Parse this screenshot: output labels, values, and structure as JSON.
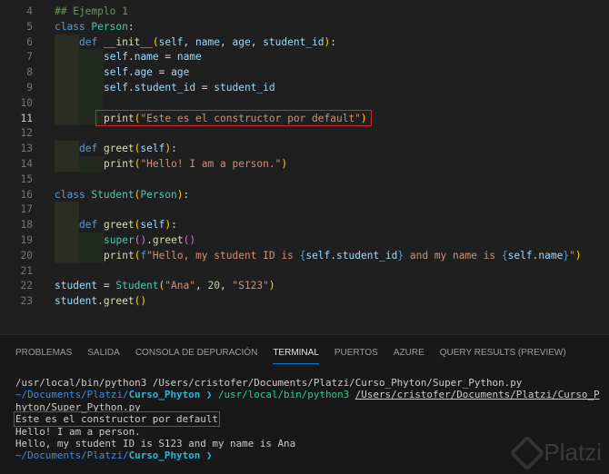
{
  "editor": {
    "active_line": 11,
    "lines": [
      {
        "n": "4",
        "indent": 0,
        "tokens": [
          [
            "## Ejemplo 1",
            "cm"
          ]
        ]
      },
      {
        "n": "5",
        "indent": 0,
        "tokens": [
          [
            "class ",
            "kw"
          ],
          [
            "Person",
            "cls"
          ],
          [
            ":",
            "pn"
          ]
        ]
      },
      {
        "n": "6",
        "indent": 1,
        "tokens": [
          [
            "def ",
            "kw"
          ],
          [
            "__init__",
            "fn"
          ],
          [
            "(",
            "br"
          ],
          [
            "self",
            "self"
          ],
          [
            ", ",
            "pn"
          ],
          [
            "name",
            "var"
          ],
          [
            ", ",
            "pn"
          ],
          [
            "age",
            "var"
          ],
          [
            ", ",
            "pn"
          ],
          [
            "student_id",
            "var"
          ],
          [
            ")",
            "br"
          ],
          [
            ":",
            "pn"
          ]
        ]
      },
      {
        "n": "7",
        "indent": 2,
        "tokens": [
          [
            "self",
            "self"
          ],
          [
            ".",
            "pn"
          ],
          [
            "name",
            "var"
          ],
          [
            " = ",
            "pn"
          ],
          [
            "name",
            "var"
          ]
        ]
      },
      {
        "n": "8",
        "indent": 2,
        "tokens": [
          [
            "self",
            "self"
          ],
          [
            ".",
            "pn"
          ],
          [
            "age",
            "var"
          ],
          [
            " = ",
            "pn"
          ],
          [
            "age",
            "var"
          ]
        ]
      },
      {
        "n": "9",
        "indent": 2,
        "tokens": [
          [
            "self",
            "self"
          ],
          [
            ".",
            "pn"
          ],
          [
            "student_id",
            "var"
          ],
          [
            " = ",
            "pn"
          ],
          [
            "student_id",
            "var"
          ]
        ]
      },
      {
        "n": "10",
        "indent": 2,
        "tokens": []
      },
      {
        "n": "11",
        "indent": 2,
        "tokens": [
          [
            "print",
            "fn"
          ],
          [
            "(",
            "br"
          ],
          [
            "\"Este es el constructor por default\"",
            "str"
          ],
          [
            ")",
            "br"
          ]
        ]
      },
      {
        "n": "12",
        "indent": 0,
        "tokens": []
      },
      {
        "n": "13",
        "indent": 1,
        "tokens": [
          [
            "def ",
            "kw"
          ],
          [
            "greet",
            "fn"
          ],
          [
            "(",
            "br"
          ],
          [
            "self",
            "self"
          ],
          [
            ")",
            "br"
          ],
          [
            ":",
            "pn"
          ]
        ]
      },
      {
        "n": "14",
        "indent": 2,
        "tokens": [
          [
            "print",
            "fn"
          ],
          [
            "(",
            "br"
          ],
          [
            "\"Hello! I am a person.\"",
            "str"
          ],
          [
            ")",
            "br"
          ]
        ]
      },
      {
        "n": "15",
        "indent": 0,
        "tokens": []
      },
      {
        "n": "16",
        "indent": 0,
        "tokens": [
          [
            "class ",
            "kw"
          ],
          [
            "Student",
            "cls"
          ],
          [
            "(",
            "br"
          ],
          [
            "Person",
            "cls"
          ],
          [
            ")",
            "br"
          ],
          [
            ":",
            "pn"
          ]
        ]
      },
      {
        "n": "17",
        "indent": 1,
        "tokens": []
      },
      {
        "n": "18",
        "indent": 1,
        "tokens": [
          [
            "def ",
            "kw"
          ],
          [
            "greet",
            "fn"
          ],
          [
            "(",
            "br"
          ],
          [
            "self",
            "self"
          ],
          [
            ")",
            "br"
          ],
          [
            ":",
            "pn"
          ]
        ]
      },
      {
        "n": "19",
        "indent": 2,
        "tokens": [
          [
            "super",
            "cls"
          ],
          [
            "()",
            "br2"
          ],
          [
            ".",
            "pn"
          ],
          [
            "greet",
            "fn"
          ],
          [
            "()",
            "br2"
          ]
        ]
      },
      {
        "n": "20",
        "indent": 2,
        "tokens": [
          [
            "print",
            "fn"
          ],
          [
            "(",
            "br"
          ],
          [
            "f",
            "kw"
          ],
          [
            "\"Hello, my student ID is ",
            "str"
          ],
          [
            "{",
            "kw"
          ],
          [
            "self",
            "self"
          ],
          [
            ".",
            "pn"
          ],
          [
            "student_id",
            "var"
          ],
          [
            "}",
            "kw"
          ],
          [
            " and my name is ",
            "str"
          ],
          [
            "{",
            "kw"
          ],
          [
            "self",
            "self"
          ],
          [
            ".",
            "pn"
          ],
          [
            "name",
            "var"
          ],
          [
            "}",
            "kw"
          ],
          [
            "\"",
            "str"
          ],
          [
            ")",
            "br"
          ]
        ]
      },
      {
        "n": "21",
        "indent": 0,
        "tokens": []
      },
      {
        "n": "22",
        "indent": 0,
        "tokens": [
          [
            "student",
            "var"
          ],
          [
            " = ",
            "pn"
          ],
          [
            "Student",
            "cls"
          ],
          [
            "(",
            "br"
          ],
          [
            "\"Ana\"",
            "str"
          ],
          [
            ", ",
            "pn"
          ],
          [
            "20",
            "num"
          ],
          [
            ", ",
            "pn"
          ],
          [
            "\"S123\"",
            "str"
          ],
          [
            ")",
            "br"
          ]
        ]
      },
      {
        "n": "23",
        "indent": 0,
        "tokens": [
          [
            "student",
            "var"
          ],
          [
            ".",
            "pn"
          ],
          [
            "greet",
            "fn"
          ],
          [
            "()",
            "br"
          ]
        ]
      }
    ]
  },
  "panel": {
    "tabs": [
      {
        "label": "PROBLEMAS",
        "active": false
      },
      {
        "label": "SALIDA",
        "active": false
      },
      {
        "label": "CONSOLA DE DEPURACIÓN",
        "active": false
      },
      {
        "label": "TERMINAL",
        "active": true
      },
      {
        "label": "PUERTOS",
        "active": false
      },
      {
        "label": "AZURE",
        "active": false
      },
      {
        "label": "QUERY RESULTS (PREVIEW)",
        "active": false
      }
    ],
    "terminal": {
      "line1": "/usr/local/bin/python3 /Users/cristofer/Documents/Platzi/Curso_Phyton/Super_Python.py",
      "prompt_path": "~/Documents/Platzi/",
      "prompt_dir": "Curso_Phyton",
      "prompt_arrow": " ❯ ",
      "cmd_exe": "/usr/local/bin/python3 ",
      "cmd_arg": "/Users/cristofer/Documents/Platzi/Curso_Phyton/Super_Python.py",
      "out1": "Este es el constructor por default",
      "out2": "Hello! I am a person.",
      "out3": "Hello, my student ID is S123 and my name is Ana"
    }
  },
  "watermark": "Platzi"
}
